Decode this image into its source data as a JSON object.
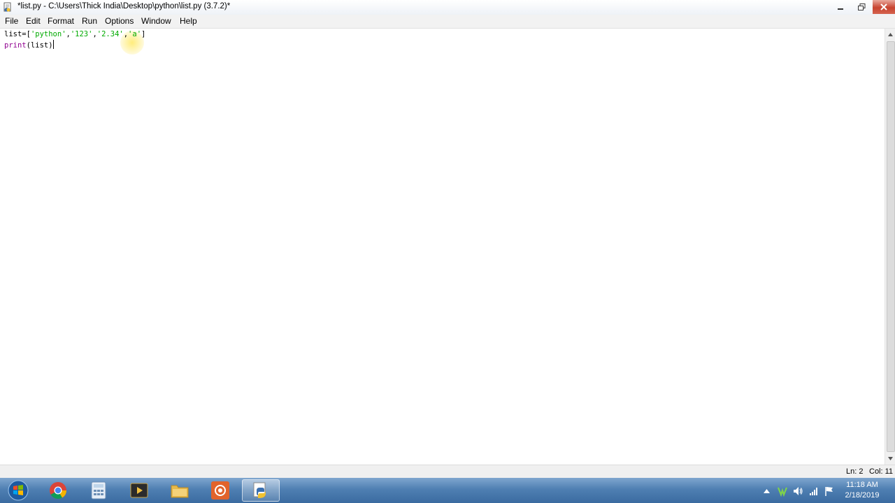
{
  "window": {
    "title": "*list.py - C:\\Users\\Thick India\\Desktop\\python\\list.py (3.7.2)*"
  },
  "menu": {
    "items": [
      "File",
      "Edit",
      "Format",
      "Run",
      "Options",
      "Window",
      "Help"
    ]
  },
  "editor": {
    "lines": [
      {
        "tokens": [
          {
            "text": "list=[",
            "kind": "plain"
          },
          {
            "text": "'python'",
            "kind": "str"
          },
          {
            "text": ",",
            "kind": "plain"
          },
          {
            "text": "'123'",
            "kind": "str"
          },
          {
            "text": ",",
            "kind": "plain"
          },
          {
            "text": "'2.34'",
            "kind": "str"
          },
          {
            "text": ",",
            "kind": "plain"
          },
          {
            "text": "'a'",
            "kind": "str"
          },
          {
            "text": "]",
            "kind": "plain"
          }
        ]
      },
      {
        "tokens": [
          {
            "text": "print",
            "kind": "builtin"
          },
          {
            "text": "(list)",
            "kind": "plain"
          }
        ]
      }
    ]
  },
  "status": {
    "line": "Ln: 2",
    "col": "Col: 11"
  },
  "taskbar": {
    "apps": [
      "start-orb",
      "chrome",
      "calculator",
      "media-player",
      "file-explorer",
      "recorder",
      "python-idle"
    ],
    "active_app": "python-idle",
    "time": "11:18 AM",
    "date": "2/18/2019"
  },
  "colors": {
    "string": "#00aa00",
    "builtin": "#900090",
    "taskbar": "#4f7fb2"
  }
}
